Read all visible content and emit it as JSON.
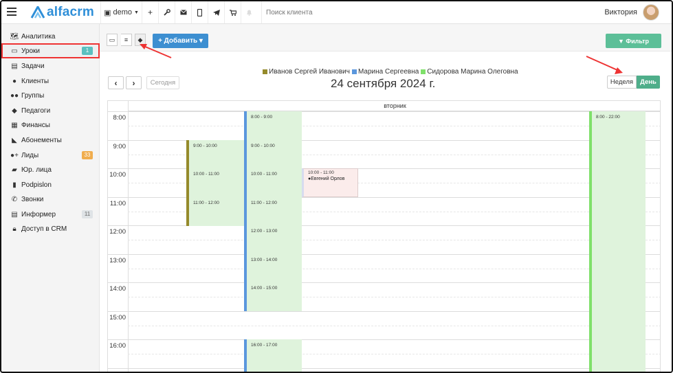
{
  "topbar": {
    "brand": "alfacrm",
    "demo_label": "demo",
    "search_placeholder": "Поиск клиента",
    "user_name": "Виктория"
  },
  "sidebar": {
    "items": [
      {
        "label": "Аналитика",
        "icon": "map-icon"
      },
      {
        "label": "Уроки",
        "icon": "calendar-icon",
        "badge": "1",
        "active": true
      },
      {
        "label": "Задачи",
        "icon": "clipboard-icon"
      },
      {
        "label": "Клиенты",
        "icon": "user-icon"
      },
      {
        "label": "Группы",
        "icon": "users-icon"
      },
      {
        "label": "Педагоги",
        "icon": "graduation-cap-icon"
      },
      {
        "label": "Финансы",
        "icon": "money-icon"
      },
      {
        "label": "Абонементы",
        "icon": "tag-icon"
      },
      {
        "label": "Лиды",
        "icon": "user-plus-icon",
        "badge": "33"
      },
      {
        "label": "Юр. лица",
        "icon": "briefcase-icon"
      },
      {
        "label": "Podpislon",
        "icon": "document-icon"
      },
      {
        "label": "Звонки",
        "icon": "phone-icon"
      },
      {
        "label": "Информер",
        "icon": "list-icon",
        "badge": "11"
      },
      {
        "label": "Доступ в CRM",
        "icon": "lock-icon"
      }
    ],
    "badge_colors": {
      "Уроки": "#5bc0c0",
      "Лиды": "#f0ad4e",
      "Информер": "#dfe3e6"
    }
  },
  "toolbar": {
    "add_label": "+ Добавить ▾",
    "filter_label": "▼ Фильтр"
  },
  "calendar": {
    "legend": [
      {
        "name": "Иванов Сергей Иванович",
        "color": "#958a2b"
      },
      {
        "name": "Марина Сергеевна",
        "color": "#5b97dd"
      },
      {
        "name": "Сидорова Марина Олеговна",
        "color": "#7fe06a"
      }
    ],
    "today_label": "Сегодня",
    "date_title": "24 сентября 2024 г.",
    "week_label": "Неделя",
    "day_label": "День",
    "day_header": "вторник",
    "hours": [
      "8:00",
      "9:00",
      "10:00",
      "11:00",
      "12:00",
      "13:00",
      "14:00",
      "15:00",
      "16:00"
    ],
    "events": [
      {
        "time": "9:00 - 10:00",
        "teacher": "Иванов Сергей Иванович"
      },
      {
        "time": "10:00 - 11:00",
        "teacher": "Иванов Сергей Иванович"
      },
      {
        "time": "11:00 - 12:00",
        "teacher": "Иванов Сергей Иванович"
      },
      {
        "time": "8:00 - 9:00",
        "teacher": "Марина Сергеевна"
      },
      {
        "time": "9:00 - 10:00",
        "teacher": "Марина Сергеевна"
      },
      {
        "time": "10:00 - 11:00",
        "teacher": "Марина Сергеевна"
      },
      {
        "time": "11:00 - 12:00",
        "teacher": "Марина Сергеевна"
      },
      {
        "time": "12:00 - 13:00",
        "teacher": "Марина Сергеевна"
      },
      {
        "time": "13:00 - 14:00",
        "teacher": "Марина Сергеевна"
      },
      {
        "time": "14:00 - 15:00",
        "teacher": "Марина Сергеевна"
      },
      {
        "time": "16:00 - 17:00",
        "teacher": "Марина Сергеевна"
      },
      {
        "time": "10:00 - 11:00",
        "client": "Евгений Орлов"
      },
      {
        "time": "8:00 - 22:00",
        "teacher": "Сидорова Марина Олеговна"
      }
    ]
  },
  "colors": {
    "accent_blue": "#3d8fd1",
    "accent_green": "#5cbf98",
    "day_button": "#4fae8a",
    "event_green": "#dff3dc",
    "event_pink": "#fbeceb",
    "highlight_red": "#e33333"
  }
}
